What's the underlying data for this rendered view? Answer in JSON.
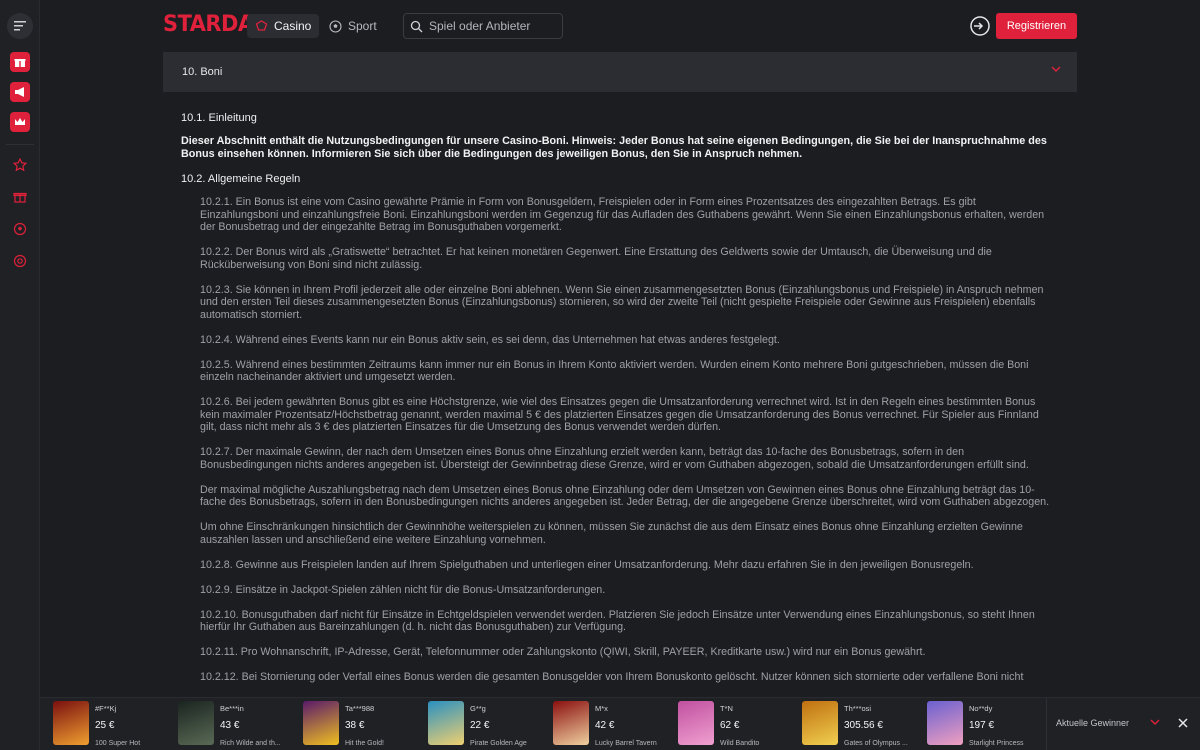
{
  "header": {
    "logo": "STARDA",
    "nav": {
      "casino": "Casino",
      "sport": "Sport"
    },
    "search_placeholder": "Spiel oder Anbieter",
    "register": "Registrieren"
  },
  "section": {
    "title": "10. Boni",
    "h_intro": "10.1.  Einleitung",
    "intro": "Dieser Abschnitt enthält die Nutzungsbedingungen für unsere Casino-Boni. Hinweis: Jeder Bonus hat seine eigenen Bedingungen, die Sie bei der Inanspruchnahme des Bonus einsehen können. Informieren Sie sich über die Bedingungen des jeweiligen Bonus, den Sie in Anspruch nehmen.",
    "h_rules": "10.2.  Allgemeine Regeln",
    "paragraphs": [
      "10.2.1. Ein Bonus ist eine vom Casino gewährte Prämie in Form von Bonusgeldern, Freispielen oder in Form eines Prozentsatzes des eingezahlten Betrags. Es gibt Einzahlungsboni und einzahlungsfreie Boni. Einzahlungsboni werden im Gegenzug für das Aufladen des Guthabens gewährt. Wenn Sie einen Einzahlungsbonus erhalten, werden der Bonusbetrag und der eingezahlte Betrag im Bonusguthaben vorgemerkt.",
      "10.2.2. Der Bonus wird als „Gratiswette“ betrachtet. Er hat keinen monetären Gegenwert. Eine Erstattung des Geldwerts sowie der Umtausch, die Überweisung und die Rücküberweisung von Boni sind nicht zulässig.",
      "10.2.3. Sie können in Ihrem Profil jederzeit alle oder einzelne Boni ablehnen. Wenn Sie einen zusammengesetzten Bonus (Einzahlungsbonus und Freispiele) in Anspruch nehmen und den ersten Teil dieses zusammengesetzten Bonus (Einzahlungsbonus) stornieren, so wird der zweite Teil (nicht gespielte Freispiele oder Gewinne aus Freispielen) ebenfalls automatisch storniert.",
      "10.2.4. Während eines Events kann nur ein Bonus aktiv sein, es sei denn, das Unternehmen hat etwas anderes festgelegt.",
      "10.2.5. Während eines bestimmten Zeitraums kann immer nur ein Bonus in Ihrem Konto aktiviert werden. Wurden einem Konto mehrere Boni gutgeschrieben, müssen die Boni einzeln nacheinander aktiviert und umgesetzt werden.",
      "10.2.6. Bei jedem gewährten Bonus gibt es eine Höchstgrenze, wie viel des Einsatzes gegen die Umsatzanforderung verrechnet wird. Ist in den Regeln eines bestimmten Bonus kein maximaler Prozentsatz/Höchstbetrag genannt, werden maximal 5 € des platzierten Einsatzes gegen die Umsatzanforderung des Bonus verrechnet. Für Spieler aus Finnland gilt, dass nicht mehr als 3 € des platzierten Einsatzes für die Umsetzung des Bonus verwendet werden dürfen.",
      "10.2.7. Der maximale Gewinn, der nach dem Umsetzen eines Bonus ohne Einzahlung erzielt werden kann, beträgt das 10-fache des Bonusbetrags, sofern in den Bonusbedingungen nichts anderes angegeben ist. Übersteigt der Gewinnbetrag diese Grenze, wird er vom Guthaben abgezogen, sobald die Umsatzanforderungen erfüllt sind.",
      "Der maximal mögliche Auszahlungsbetrag nach dem Umsetzen eines Bonus ohne Einzahlung oder dem Umsetzen von Gewinnen eines Bonus ohne Einzahlung beträgt das 10-fache des Bonusbetrags, sofern in den Bonusbedingungen nichts anderes angegeben ist. Jeder Betrag, der die angegebene Grenze überschreitet, wird vom Guthaben abgezogen.",
      "Um ohne Einschränkungen hinsichtlich der Gewinnhöhe weiterspielen zu können, müssen Sie zunächst die aus dem Einsatz eines Bonus ohne Einzahlung erzielten Gewinne auszahlen lassen und anschließend eine weitere Einzahlung vornehmen.",
      "10.2.8. Gewinne aus Freispielen landen auf Ihrem Spielguthaben und unterliegen einer Umsatzanforderung. Mehr dazu erfahren Sie in den jeweiligen Bonusregeln.",
      "10.2.9. Einsätze in Jackpot-Spielen zählen nicht für die Bonus-Umsatzanforderungen.",
      "10.2.10. Bonusguthaben darf nicht für Einsätze in Echtgeldspielen verwendet werden. Platzieren Sie jedoch Einsätze unter Verwendung eines Einzahlungsbonus, so steht Ihnen hierfür Ihr Guthaben aus Bareinzahlungen (d. h. nicht das Bonusguthaben) zur Verfügung.",
      "10.2.11. Pro Wohnanschrift, IP-Adresse, Gerät, Telefonnummer oder Zahlungskonto (QIWI, Skrill, PAYEER, Kreditkarte usw.) wird nur ein Bonus gewährt.",
      "10.2.12. Bei Stornierung oder Verfall eines Bonus werden die gesamten Bonusgelder von Ihrem Bonuskonto gelöscht. Nutzer können sich stornierte oder verfallene Boni nicht"
    ]
  },
  "winners": {
    "label": "Aktuelle Gewinner",
    "items": [
      {
        "name": "#F**Kj",
        "amount": "25 €",
        "game": "100 Super Hot",
        "c1": "#7a1010",
        "c2": "#f0a030"
      },
      {
        "name": "Be***in",
        "amount": "43 €",
        "game": "Rich Wilde and th...",
        "c1": "#1a2420",
        "c2": "#5a6a55"
      },
      {
        "name": "Ta***988",
        "amount": "38 €",
        "game": "Hit the Gold!",
        "c1": "#5a1a6a",
        "c2": "#f0c020"
      },
      {
        "name": "G**g",
        "amount": "22 €",
        "game": "Pirate Golden Age",
        "c1": "#2a90c0",
        "c2": "#f0d070"
      },
      {
        "name": "M*x",
        "amount": "42 €",
        "game": "Lucky Barrel Tavern",
        "c1": "#8a1010",
        "c2": "#f0d0a0"
      },
      {
        "name": "T*N",
        "amount": "62 €",
        "game": "Wild Bandito",
        "c1": "#c050a0",
        "c2": "#f0a0d0"
      },
      {
        "name": "Th***osi",
        "amount": "305.56 €",
        "game": "Gates of Olympus ...",
        "c1": "#c07010",
        "c2": "#f0d050"
      },
      {
        "name": "No**dy",
        "amount": "197 €",
        "game": "Starlight Princess",
        "c1": "#6a60d0",
        "c2": "#f0a0c0"
      }
    ]
  }
}
